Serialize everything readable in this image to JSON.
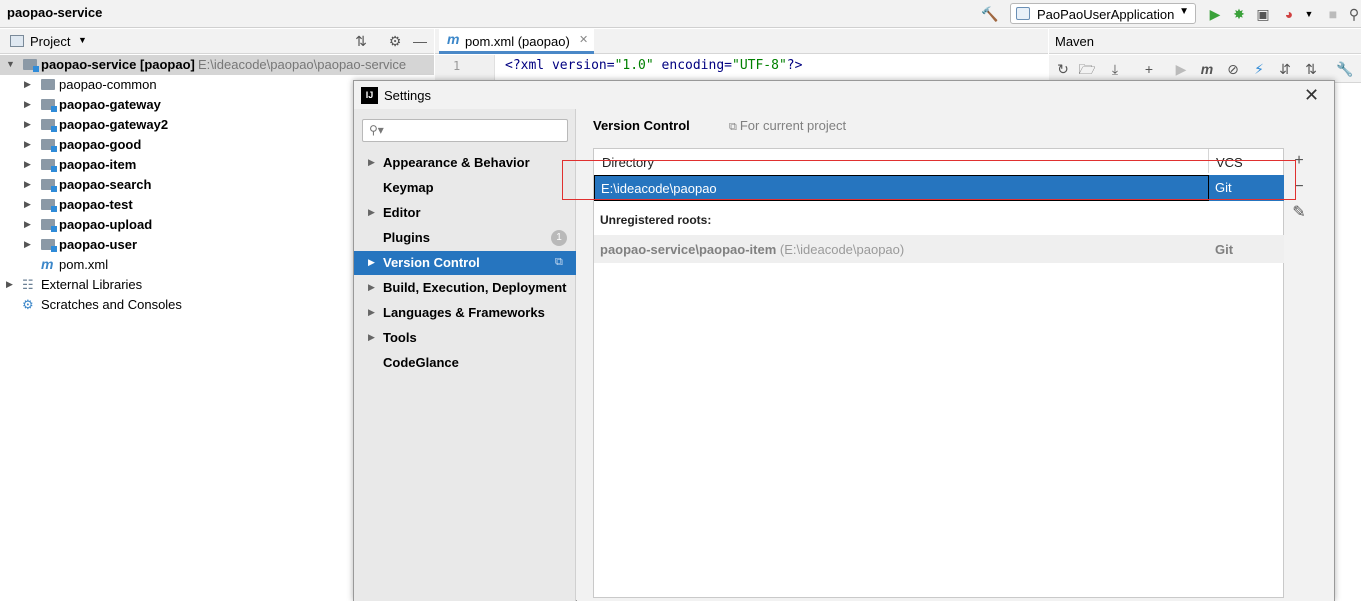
{
  "topbar": {
    "project_name": "paopao-service",
    "run_config": "PaoPaoUserApplication",
    "icons": [
      "hammer-icon",
      "run-icon",
      "debug-icon",
      "coverage-icon",
      "profile-icon",
      "stop-icon",
      "search-icon"
    ]
  },
  "project_panel": {
    "title": "Project",
    "root_name": "paopao-service [paopao]",
    "root_path": "E:\\ideacode\\paopao\\paopao-service",
    "modules": [
      "paopao-common",
      "paopao-gateway",
      "paopao-gateway2",
      "paopao-good",
      "paopao-item",
      "paopao-search",
      "paopao-test",
      "paopao-upload",
      "paopao-user"
    ],
    "pom_file": "pom.xml",
    "external_libraries": "External Libraries",
    "scratches": "Scratches and Consoles"
  },
  "editor": {
    "tab_label": "pom.xml (paopao)",
    "line_number": "1",
    "code_prefix": "<?xml version=",
    "code_v1": "\"1.0\"",
    "code_mid": " encoding=",
    "code_v2": "\"UTF-8\"",
    "code_suffix": "?>"
  },
  "maven": {
    "title": "Maven"
  },
  "settings": {
    "title": "Settings",
    "search_placeholder": "",
    "nav": [
      {
        "label": "Appearance & Behavior",
        "expandable": true
      },
      {
        "label": "Keymap",
        "expandable": false
      },
      {
        "label": "Editor",
        "expandable": true
      },
      {
        "label": "Plugins",
        "expandable": false,
        "badge": "1"
      },
      {
        "label": "Version Control",
        "expandable": true,
        "active": true
      },
      {
        "label": "Build, Execution, Deployment",
        "expandable": true
      },
      {
        "label": "Languages & Frameworks",
        "expandable": true
      },
      {
        "label": "Tools",
        "expandable": true
      },
      {
        "label": "CodeGlance",
        "expandable": false
      }
    ],
    "panel_title": "Version Control",
    "scope": "For current project",
    "table": {
      "col_directory": "Directory",
      "col_vcs": "VCS",
      "mapping_directory": "E:\\ideacode\\paopao",
      "mapping_vcs": "Git",
      "unregistered_label": "Unregistered roots:",
      "unregistered_path": "paopao-service\\paopao-item",
      "unregistered_location": "(E:\\ideacode\\paopao)",
      "unregistered_vcs": "Git"
    },
    "colors": {
      "selection": "#2675bf",
      "highlight": "#e0302f"
    }
  }
}
